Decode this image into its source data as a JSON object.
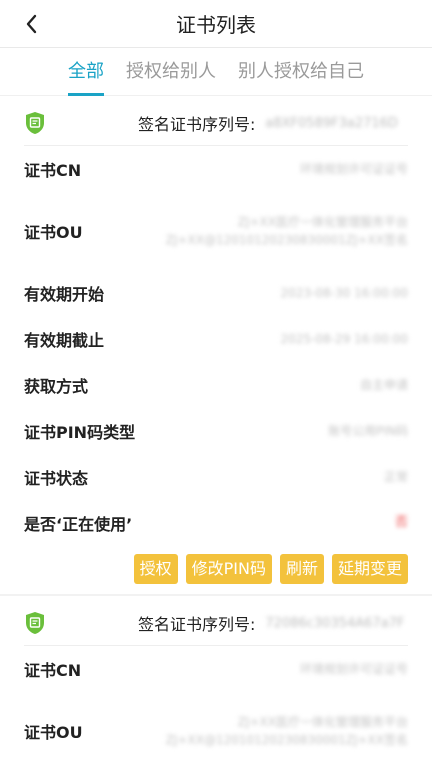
{
  "header": {
    "title": "证书列表"
  },
  "tabs": [
    {
      "label": "全部",
      "active": true
    },
    {
      "label": "授权给别人",
      "active": false
    },
    {
      "label": "别人授权给自己",
      "active": false
    }
  ],
  "colors": {
    "accent": "#1aa3c6",
    "button": "#f3c23c",
    "icon": "#6abf3b"
  },
  "cards": [
    {
      "serial_label": "签名证书序列号:",
      "serial_value": "a8XF0589F3a2716D",
      "rows": [
        {
          "label": "证书CN",
          "value": "环境规划许可证证号"
        },
        {
          "label": "证书OU",
          "value": "ZJ+XX医疗一体化管理服务平台ZJ+XX@12010120230830001ZJ+XX签名"
        },
        {
          "label": "有效期开始",
          "value": "2023-08-30 16:00:00"
        },
        {
          "label": "有效期截止",
          "value": "2025-08-29 16:00:00"
        },
        {
          "label": "获取方式",
          "value": "自主申请"
        },
        {
          "label": "证书PIN码类型",
          "value": "账号公用PIN码"
        },
        {
          "label": "证书状态",
          "value": "正常"
        },
        {
          "label": "是否‘正在使用’",
          "value": "否"
        }
      ],
      "buttons": [
        "授权",
        "修改PIN码",
        "刷新",
        "延期变更"
      ]
    },
    {
      "serial_label": "签名证书序列号:",
      "serial_value": "72086c30354A67a7F",
      "rows": [
        {
          "label": "证书CN",
          "value": "环境规划许可证证号"
        },
        {
          "label": "证书OU",
          "value": "ZJ+XX医疗一体化管理服务平台ZJ+XX@12010120230830001ZJ+XX签名"
        }
      ]
    }
  ]
}
